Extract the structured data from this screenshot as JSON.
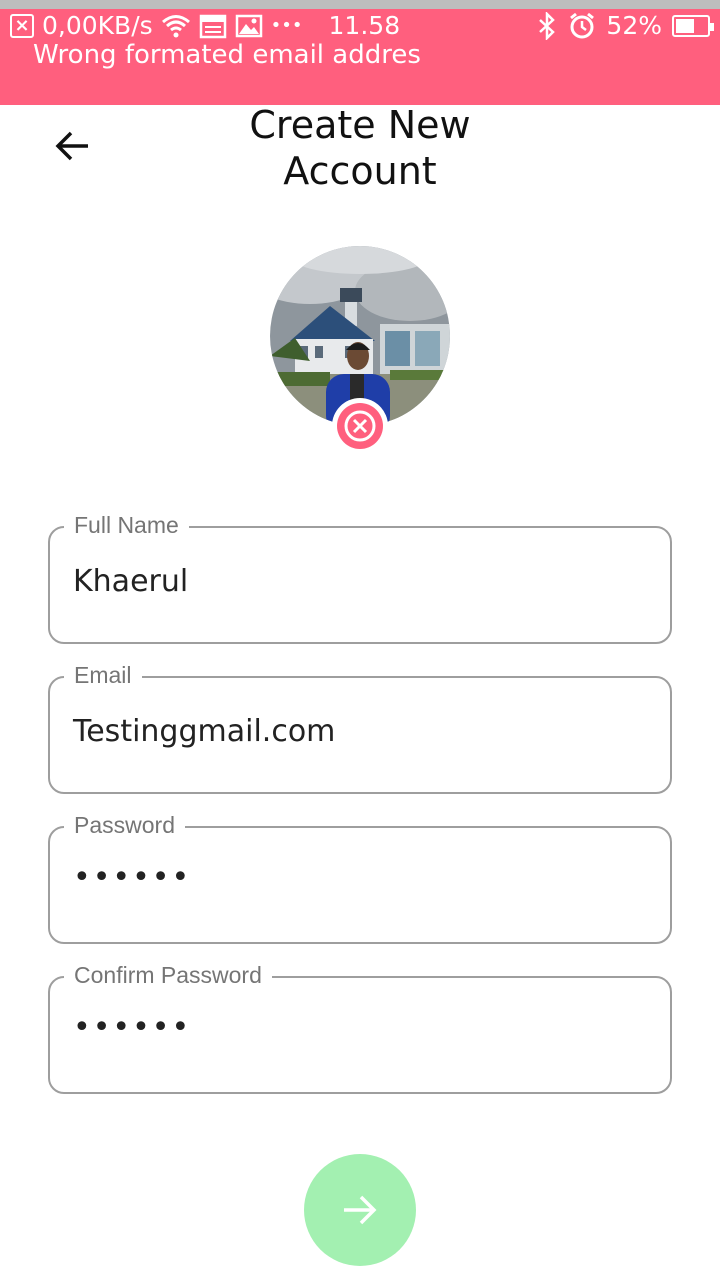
{
  "status_bar": {
    "network_speed": "0,00KB/s",
    "more": "•••",
    "time": "11.58",
    "battery": "52%",
    "icons": [
      "close-box-icon",
      "wifi-icon",
      "calendar-icon",
      "image-icon",
      "bluetooth-icon",
      "alarm-icon",
      "battery-icon"
    ]
  },
  "snackbar": {
    "message": "Wrong formated email addres",
    "color": "#ff5f7e"
  },
  "header": {
    "title_line1": "Create New",
    "title_line2": "Account",
    "back_icon": "arrow-left-icon"
  },
  "avatar": {
    "remove_icon": "close-circle-icon",
    "remove_color": "#ff5f7e"
  },
  "form": {
    "full_name": {
      "label": "Full Name",
      "value": "Khaerul"
    },
    "email": {
      "label": "Email",
      "value": "Testinggmail.com"
    },
    "password": {
      "label": "Password",
      "value": "••••••"
    },
    "confirm_password": {
      "label": "Confirm Password",
      "value": "••••••"
    }
  },
  "submit": {
    "icon": "arrow-right-icon",
    "color": "#a3f0b1"
  }
}
